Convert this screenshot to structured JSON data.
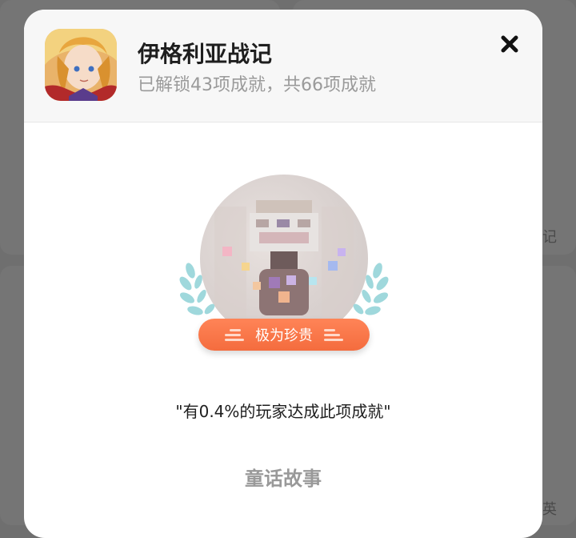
{
  "background": {
    "edge_text_1": "记",
    "edge_text_2": "英"
  },
  "modal": {
    "game_title": "伊格利亚战记",
    "progress_text": "已解锁43项成就，共66项成就",
    "close_icon": "close-icon"
  },
  "achievement": {
    "rarity_label": "极为珍贵",
    "stat_text": "\"有0.4%的玩家达成此项成就\"",
    "story_title": "童话故事"
  },
  "colors": {
    "rarity_pill": "#f4743f",
    "laurel": "#9fd8dc",
    "close_icon": "#111111"
  }
}
